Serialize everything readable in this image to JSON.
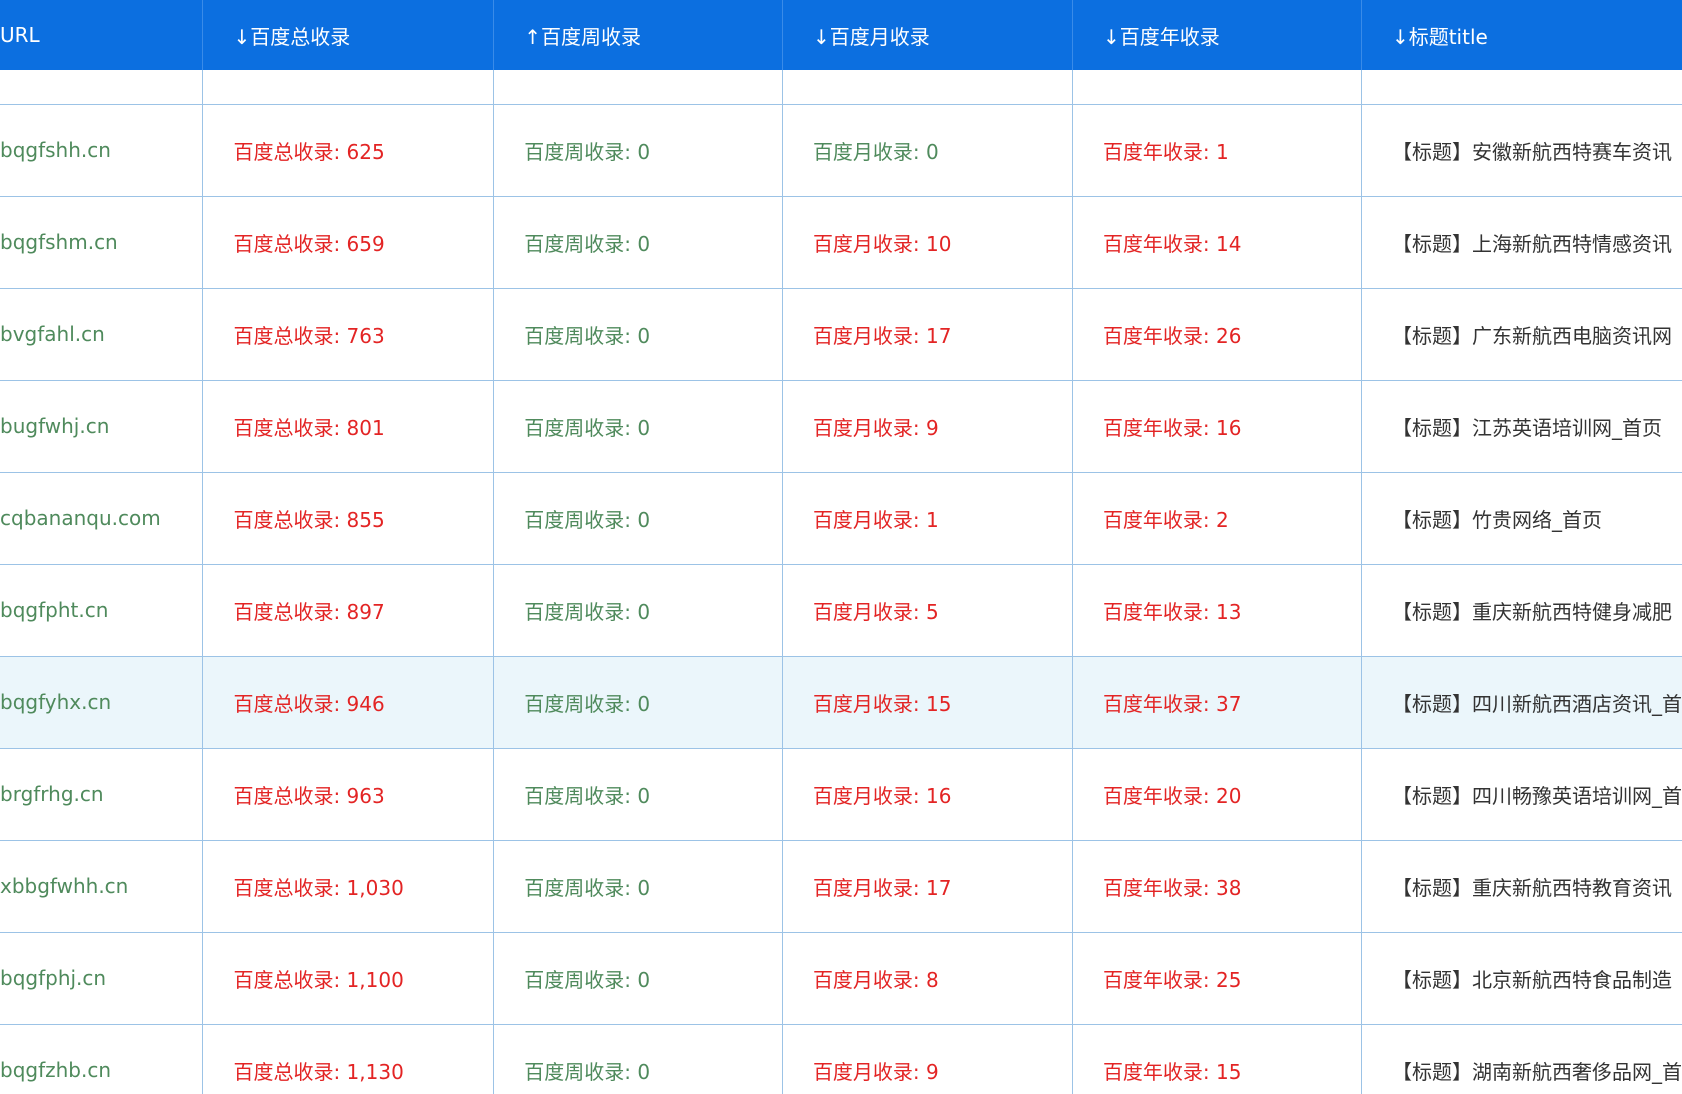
{
  "colors": {
    "header_bg": "#0c6fe0",
    "grid": "#9cc3e6",
    "highlight_row": "#ebf6fb",
    "red": "#e32424",
    "green": "#4f8a5c"
  },
  "headers": [
    "URL",
    "↓百度总收录",
    "↑百度周收录",
    "↓百度月收录",
    "↓百度年收录",
    "↓标题title"
  ],
  "rows": [
    {
      "url": "bqgfshh.cn",
      "total": "百度总收录: 625",
      "week": "百度周收录: 0",
      "month": "百度月收录: 0",
      "year": "百度年收录: 1",
      "title": "【标题】安徽新航西特赛车资讯"
    },
    {
      "url": "bqgfshm.cn",
      "total": "百度总收录: 659",
      "week": "百度周收录: 0",
      "month": "百度月收录: 10",
      "year": "百度年收录: 14",
      "title": "【标题】上海新航西特情感资讯"
    },
    {
      "url": "bvgfahl.cn",
      "total": "百度总收录: 763",
      "week": "百度周收录: 0",
      "month": "百度月收录: 17",
      "year": "百度年收录: 26",
      "title": "【标题】广东新航西电脑资讯网"
    },
    {
      "url": "bugfwhj.cn",
      "total": "百度总收录: 801",
      "week": "百度周收录: 0",
      "month": "百度月收录: 9",
      "year": "百度年收录: 16",
      "title": "【标题】江苏英语培训网_首页"
    },
    {
      "url": "cqbananqu.com",
      "total": "百度总收录: 855",
      "week": "百度周收录: 0",
      "month": "百度月收录: 1",
      "year": "百度年收录: 2",
      "title": "【标题】竹贵网络_首页"
    },
    {
      "url": "bqgfpht.cn",
      "total": "百度总收录: 897",
      "week": "百度周收录: 0",
      "month": "百度月收录: 5",
      "year": "百度年收录: 13",
      "title": "【标题】重庆新航西特健身减肥"
    },
    {
      "url": "bqgfyhx.cn",
      "total": "百度总收录: 946",
      "week": "百度周收录: 0",
      "month": "百度月收录: 15",
      "year": "百度年收录: 37",
      "title": "【标题】四川新航西酒店资讯_首"
    },
    {
      "url": "brgfrhg.cn",
      "total": "百度总收录: 963",
      "week": "百度周收录: 0",
      "month": "百度月收录: 16",
      "year": "百度年收录: 20",
      "title": "【标题】四川畅豫英语培训网_首"
    },
    {
      "url": "xbbgfwhh.cn",
      "total": "百度总收录: 1,030",
      "week": "百度周收录: 0",
      "month": "百度月收录: 17",
      "year": "百度年收录: 38",
      "title": "【标题】重庆新航西特教育资讯"
    },
    {
      "url": "bqgfphj.cn",
      "total": "百度总收录: 1,100",
      "week": "百度周收录: 0",
      "month": "百度月收录: 8",
      "year": "百度年收录: 25",
      "title": "【标题】北京新航西特食品制造"
    },
    {
      "url": "bqgfzhb.cn",
      "total": "百度总收录: 1,130",
      "week": "百度周收录: 0",
      "month": "百度月收录: 9",
      "year": "百度年收录: 15",
      "title": "【标题】湖南新航西奢侈品网_首"
    }
  ]
}
